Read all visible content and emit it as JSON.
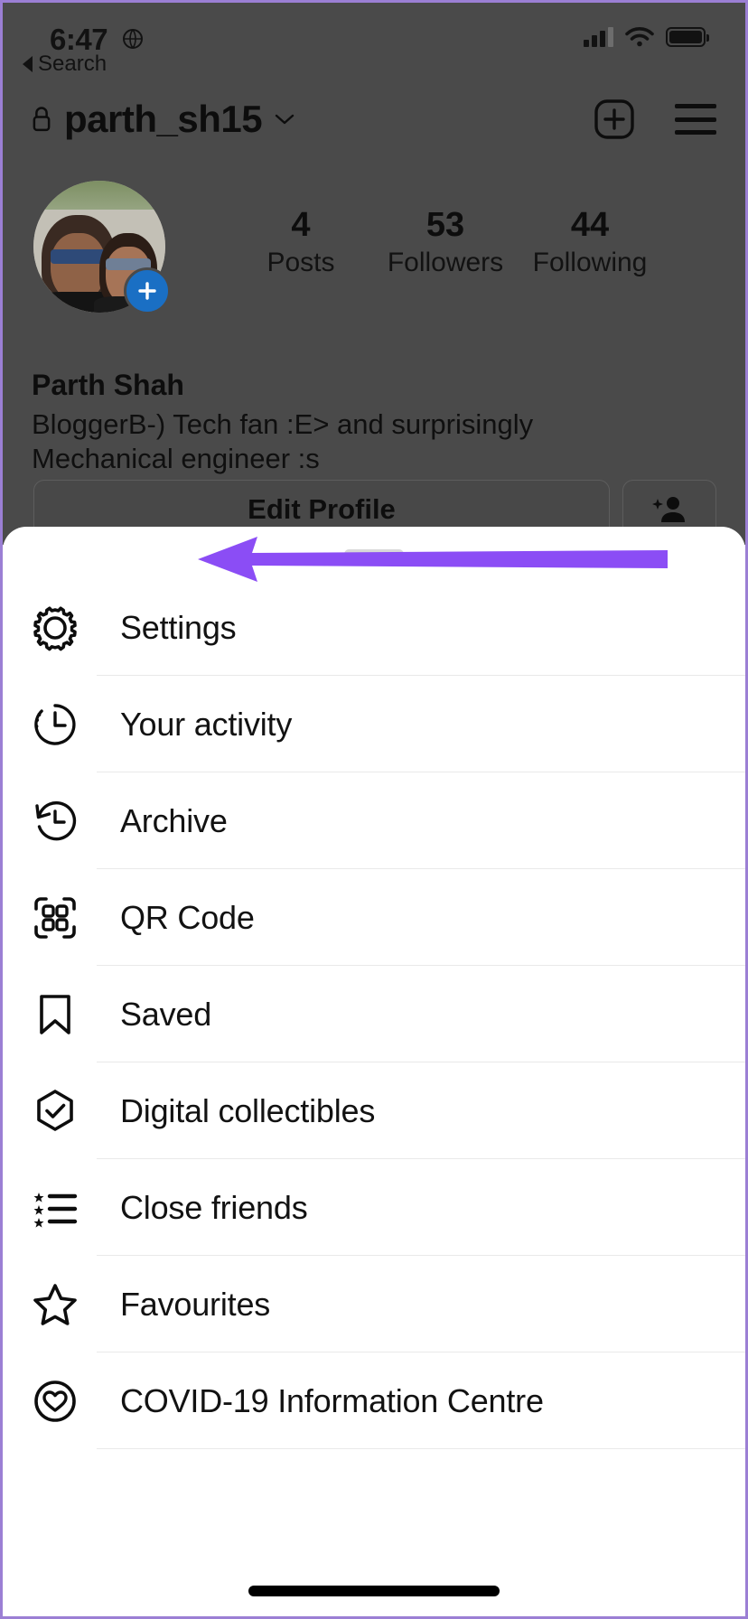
{
  "status_bar": {
    "time": "6:47",
    "location_icon": "location-services-icon",
    "signal_icon": "cellular-signal-icon",
    "wifi_icon": "wifi-icon",
    "battery_icon": "battery-full-icon"
  },
  "back_link": {
    "label": "Search",
    "icon": "back-triangle-icon"
  },
  "profile": {
    "lock_icon": "lock-icon",
    "username": "parth_sh15",
    "chevron_icon": "chevron-down-icon",
    "add_post_icon": "plus-box-icon",
    "menu_icon": "hamburger-menu-icon",
    "avatar_alt": "profile-photo",
    "add_story_icon": "plus-icon",
    "stats": [
      {
        "number": "4",
        "label": "Posts"
      },
      {
        "number": "53",
        "label": "Followers"
      },
      {
        "number": "44",
        "label": "Following"
      }
    ],
    "full_name": "Parth Shah",
    "bio": "BloggerB-) Tech fan :E> and surprisingly Mechanical engineer :s",
    "edit_profile_label": "Edit Profile",
    "add_friend_icon": "add-person-icon"
  },
  "sheet": {
    "handle": "drag-handle",
    "items": [
      {
        "label": "Settings",
        "icon": "gear-icon"
      },
      {
        "label": "Your activity",
        "icon": "activity-clock-icon"
      },
      {
        "label": "Archive",
        "icon": "clock-rewind-icon"
      },
      {
        "label": "QR Code",
        "icon": "qr-code-icon"
      },
      {
        "label": "Saved",
        "icon": "bookmark-icon"
      },
      {
        "label": "Digital collectibles",
        "icon": "hexagon-check-icon"
      },
      {
        "label": "Close friends",
        "icon": "star-list-icon"
      },
      {
        "label": "Favourites",
        "icon": "star-outline-icon"
      },
      {
        "label": "COVID-19 Information Centre",
        "icon": "heart-circle-icon"
      }
    ]
  },
  "annotation": {
    "arrow_color": "#8B4DF5",
    "points_to": "Settings"
  },
  "home_indicator": "home-indicator"
}
